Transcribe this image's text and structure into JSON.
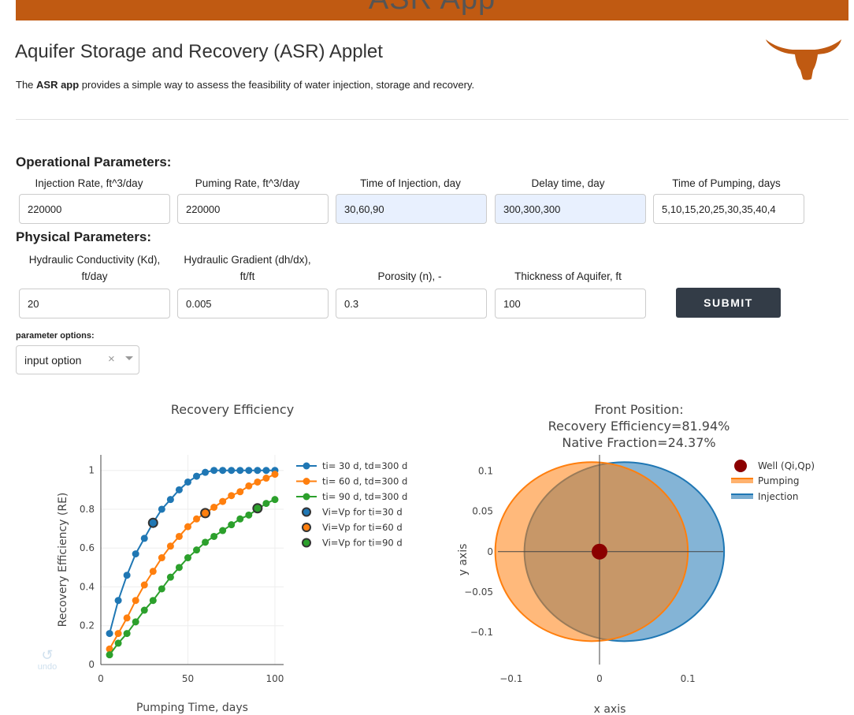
{
  "app": {
    "banner_title": "ASR App",
    "title": "Aquifer Storage and Recovery (ASR) Applet",
    "description_bold": "ASR app",
    "description_pre": "The ",
    "description_post": " provides a simple way to assess the feasibility of water injection, storage and recovery."
  },
  "operational": {
    "title": "Operational Parameters:",
    "fields": [
      {
        "label": "Injection Rate, ft^3/day",
        "value": "220000"
      },
      {
        "label": "Puming Rate, ft^3/day",
        "value": "220000"
      },
      {
        "label": "Time of Injection, day",
        "value": "30,60,90"
      },
      {
        "label": "Delay time, day",
        "value": "300,300,300"
      },
      {
        "label": "Time of Pumping, days",
        "value": "5,10,15,20,25,30,35,40,4"
      }
    ]
  },
  "physical": {
    "title": "Physical Parameters:",
    "fields": [
      {
        "label_line1": "Hydraulic Conductivity (Kd),",
        "label_line2": "ft/day",
        "value": "20"
      },
      {
        "label_line1": "Hydraulic Gradient (dh/dx),",
        "label_line2": "ft/ft",
        "value": "0.005"
      },
      {
        "label_line1": "",
        "label_line2": "Porosity (n), -",
        "value": "0.3"
      },
      {
        "label_line1": "",
        "label_line2": "Thickness of Aquifer, ft",
        "value": "100"
      }
    ],
    "submit_label": "SUBMIT"
  },
  "options": {
    "label": "parameter options:",
    "selected": "input option",
    "clear_glyph": "×"
  },
  "undo_label": "undo",
  "colors": {
    "banner": "#c05a12",
    "blue": "#1f77b4",
    "orange": "#ff7f0e",
    "green": "#2ca02c",
    "well": "#8b0000"
  },
  "chart_data": [
    {
      "type": "line",
      "title": "Recovery Efficiency",
      "xlabel": "Pumping Time, days",
      "ylabel": "Recovery Efficiency (RE)",
      "xlim": [
        0,
        105
      ],
      "ylim": [
        0,
        1.08
      ],
      "xticks": [
        0,
        50,
        100
      ],
      "yticks": [
        0,
        0.2,
        0.4,
        0.6,
        0.8,
        1
      ],
      "x": [
        5,
        10,
        15,
        20,
        25,
        30,
        35,
        40,
        45,
        50,
        55,
        60,
        65,
        70,
        75,
        80,
        85,
        90,
        95,
        100
      ],
      "series": [
        {
          "name": "ti= 30 d, td=300 d",
          "color": "#1f77b4",
          "values": [
            0.16,
            0.33,
            0.46,
            0.57,
            0.65,
            0.73,
            0.8,
            0.85,
            0.9,
            0.94,
            0.97,
            0.99,
            1.0,
            1.0,
            1.0,
            1.0,
            1.0,
            1.0,
            1.0,
            1.0
          ]
        },
        {
          "name": "ti= 60 d, td=300 d",
          "color": "#ff7f0e",
          "values": [
            0.08,
            0.16,
            0.24,
            0.33,
            0.41,
            0.48,
            0.55,
            0.61,
            0.66,
            0.71,
            0.75,
            0.78,
            0.81,
            0.84,
            0.87,
            0.89,
            0.92,
            0.94,
            0.96,
            0.98
          ]
        },
        {
          "name": "ti= 90 d, td=300 d",
          "color": "#2ca02c",
          "values": [
            0.05,
            0.11,
            0.16,
            0.22,
            0.28,
            0.33,
            0.39,
            0.45,
            0.5,
            0.55,
            0.59,
            0.63,
            0.66,
            0.69,
            0.72,
            0.75,
            0.77,
            0.8,
            0.83,
            0.85
          ]
        }
      ],
      "markers": [
        {
          "name": "Vi=Vp for ti=30 d",
          "x": 30,
          "y": 0.73,
          "color": "#1f77b4"
        },
        {
          "name": "Vi=Vp for ti=60 d",
          "x": 60,
          "y": 0.78,
          "color": "#ff7f0e"
        },
        {
          "name": "Vi=Vp for ti=90 d",
          "x": 90,
          "y": 0.805,
          "color": "#2ca02c"
        }
      ],
      "legend": "top-right",
      "grid": true
    },
    {
      "type": "scatter",
      "title_lines": [
        "Front Position:",
        "Recovery Efficiency=81.94%",
        "Native Fraction=24.37%"
      ],
      "xlabel": "x axis",
      "ylabel": "y axis",
      "xlim": [
        -0.115,
        0.14
      ],
      "ylim": [
        -0.14,
        0.12
      ],
      "xticks": [
        -0.1,
        0,
        0.1
      ],
      "xtick_labels": [
        "−0.1",
        "0",
        "0.1"
      ],
      "yticks": [
        0.1,
        0.05,
        0,
        -0.05,
        -0.1
      ],
      "ytick_labels": [
        "0.1",
        "0.05",
        "0",
        "−0.05",
        "−0.1"
      ],
      "well": {
        "name": "Well (Qi,Qp)",
        "x": 0,
        "y": 0,
        "color": "#8b0000"
      },
      "injection": {
        "name": "Injection",
        "cx": 0.028,
        "cy": 0,
        "rx": 0.113,
        "ry": 0.111,
        "color": "#1f77b4"
      },
      "pumping": {
        "name": "Pumping",
        "cx": -0.009,
        "cy": 0,
        "rx": 0.109,
        "ry": 0.111,
        "color": "#ff7f0e"
      },
      "legend": "top-right"
    }
  ]
}
